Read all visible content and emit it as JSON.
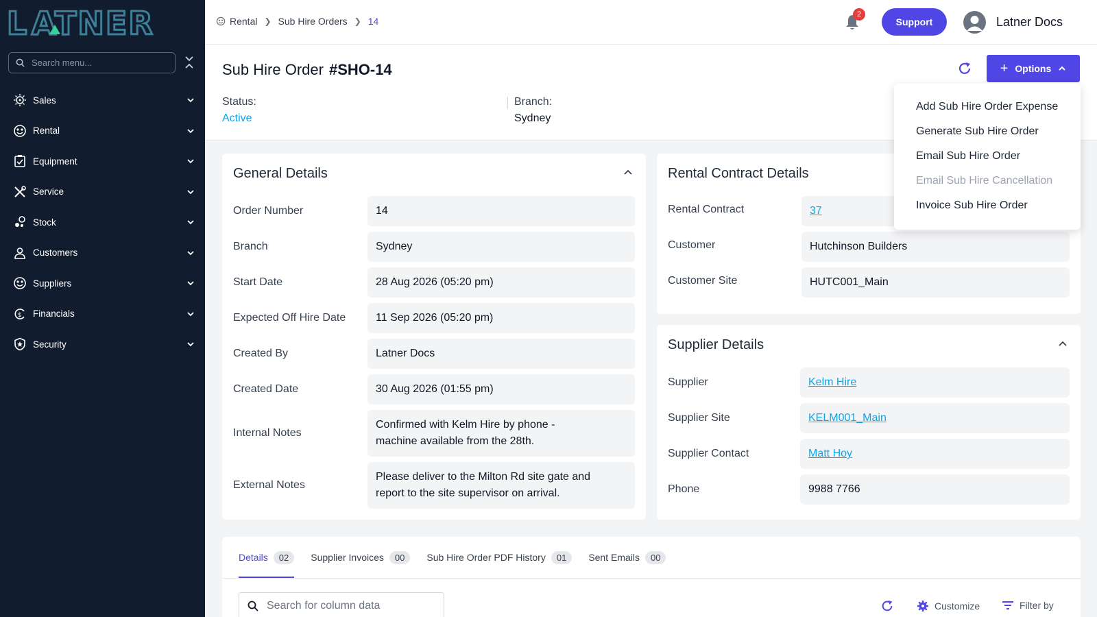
{
  "brand": {
    "logo_text": "LATNER",
    "accent": "#4f46e5",
    "sidebar_bg": "#111c2e",
    "link_color": "#0ea5e9"
  },
  "sidebar": {
    "search_placeholder": "Search menu...",
    "items": [
      {
        "label": "Sales",
        "icon": "sales-icon"
      },
      {
        "label": "Rental",
        "icon": "rental-icon"
      },
      {
        "label": "Equipment",
        "icon": "equipment-icon"
      },
      {
        "label": "Service",
        "icon": "service-icon"
      },
      {
        "label": "Stock",
        "icon": "stock-icon"
      },
      {
        "label": "Customers",
        "icon": "customers-icon"
      },
      {
        "label": "Suppliers",
        "icon": "suppliers-icon"
      },
      {
        "label": "Financials",
        "icon": "financials-icon"
      },
      {
        "label": "Security",
        "icon": "security-icon"
      }
    ]
  },
  "topbar": {
    "breadcrumb": [
      "Rental",
      "Sub Hire Orders",
      "14"
    ],
    "notification_count": "2",
    "support_label": "Support",
    "user_name": "Latner Docs"
  },
  "header": {
    "title": "Sub Hire Order",
    "order_id": "#SHO-14",
    "options_label": "Options",
    "status_label": "Status:",
    "status_value": "Active",
    "branch_label": "Branch:",
    "branch_value": "Sydney"
  },
  "options_menu": [
    {
      "label": "Add Sub Hire Order Expense",
      "disabled": false
    },
    {
      "label": "Generate Sub Hire Order",
      "disabled": false
    },
    {
      "label": "Email Sub Hire Order",
      "disabled": false
    },
    {
      "label": "Email Sub Hire Cancellation",
      "disabled": true
    },
    {
      "label": "Invoice Sub Hire Order",
      "disabled": false
    }
  ],
  "general": {
    "title": "General Details",
    "fields": [
      {
        "label": "Order Number",
        "value": "14"
      },
      {
        "label": "Branch",
        "value": "Sydney"
      },
      {
        "label": "Start Date",
        "value": "28 Aug 2026 (05:20 pm)"
      },
      {
        "label": "Expected Off Hire Date",
        "value": "11 Sep 2026 (05:20 pm)"
      },
      {
        "label": "Created By",
        "value": "Latner Docs"
      },
      {
        "label": "Created Date",
        "value": "30 Aug 2026 (01:55 pm)"
      },
      {
        "label": "Internal Notes",
        "value": "Confirmed with Kelm Hire by phone - machine available from the 28th."
      },
      {
        "label": "External Notes",
        "value": "Please deliver to the Milton Rd site gate and report to the site supervisor on arrival."
      }
    ]
  },
  "rental_contract": {
    "title": "Rental Contract Details",
    "fields": [
      {
        "label": "Rental Contract",
        "value": "37"
      },
      {
        "label": "Customer",
        "value": "Hutchinson Builders"
      },
      {
        "label": "Customer Site",
        "value": "HUTC001_Main"
      }
    ]
  },
  "supplier": {
    "title": "Supplier Details",
    "fields": [
      {
        "label": "Supplier",
        "value": "Kelm Hire"
      },
      {
        "label": "Supplier Site",
        "value": "KELM001_Main"
      },
      {
        "label": "Supplier Contact",
        "value": "Matt Hoy"
      },
      {
        "label": "Phone",
        "value": "9988 7766"
      }
    ]
  },
  "tabs": [
    {
      "label": "Details",
      "count": "02"
    },
    {
      "label": "Supplier Invoices",
      "count": "00"
    },
    {
      "label": "Sub Hire Order PDF History",
      "count": "01"
    },
    {
      "label": "Sent Emails",
      "count": "00"
    }
  ],
  "table_tools": {
    "search_placeholder": "Search for column data",
    "customize_label": "Customize",
    "filter_label": "Filter by"
  }
}
